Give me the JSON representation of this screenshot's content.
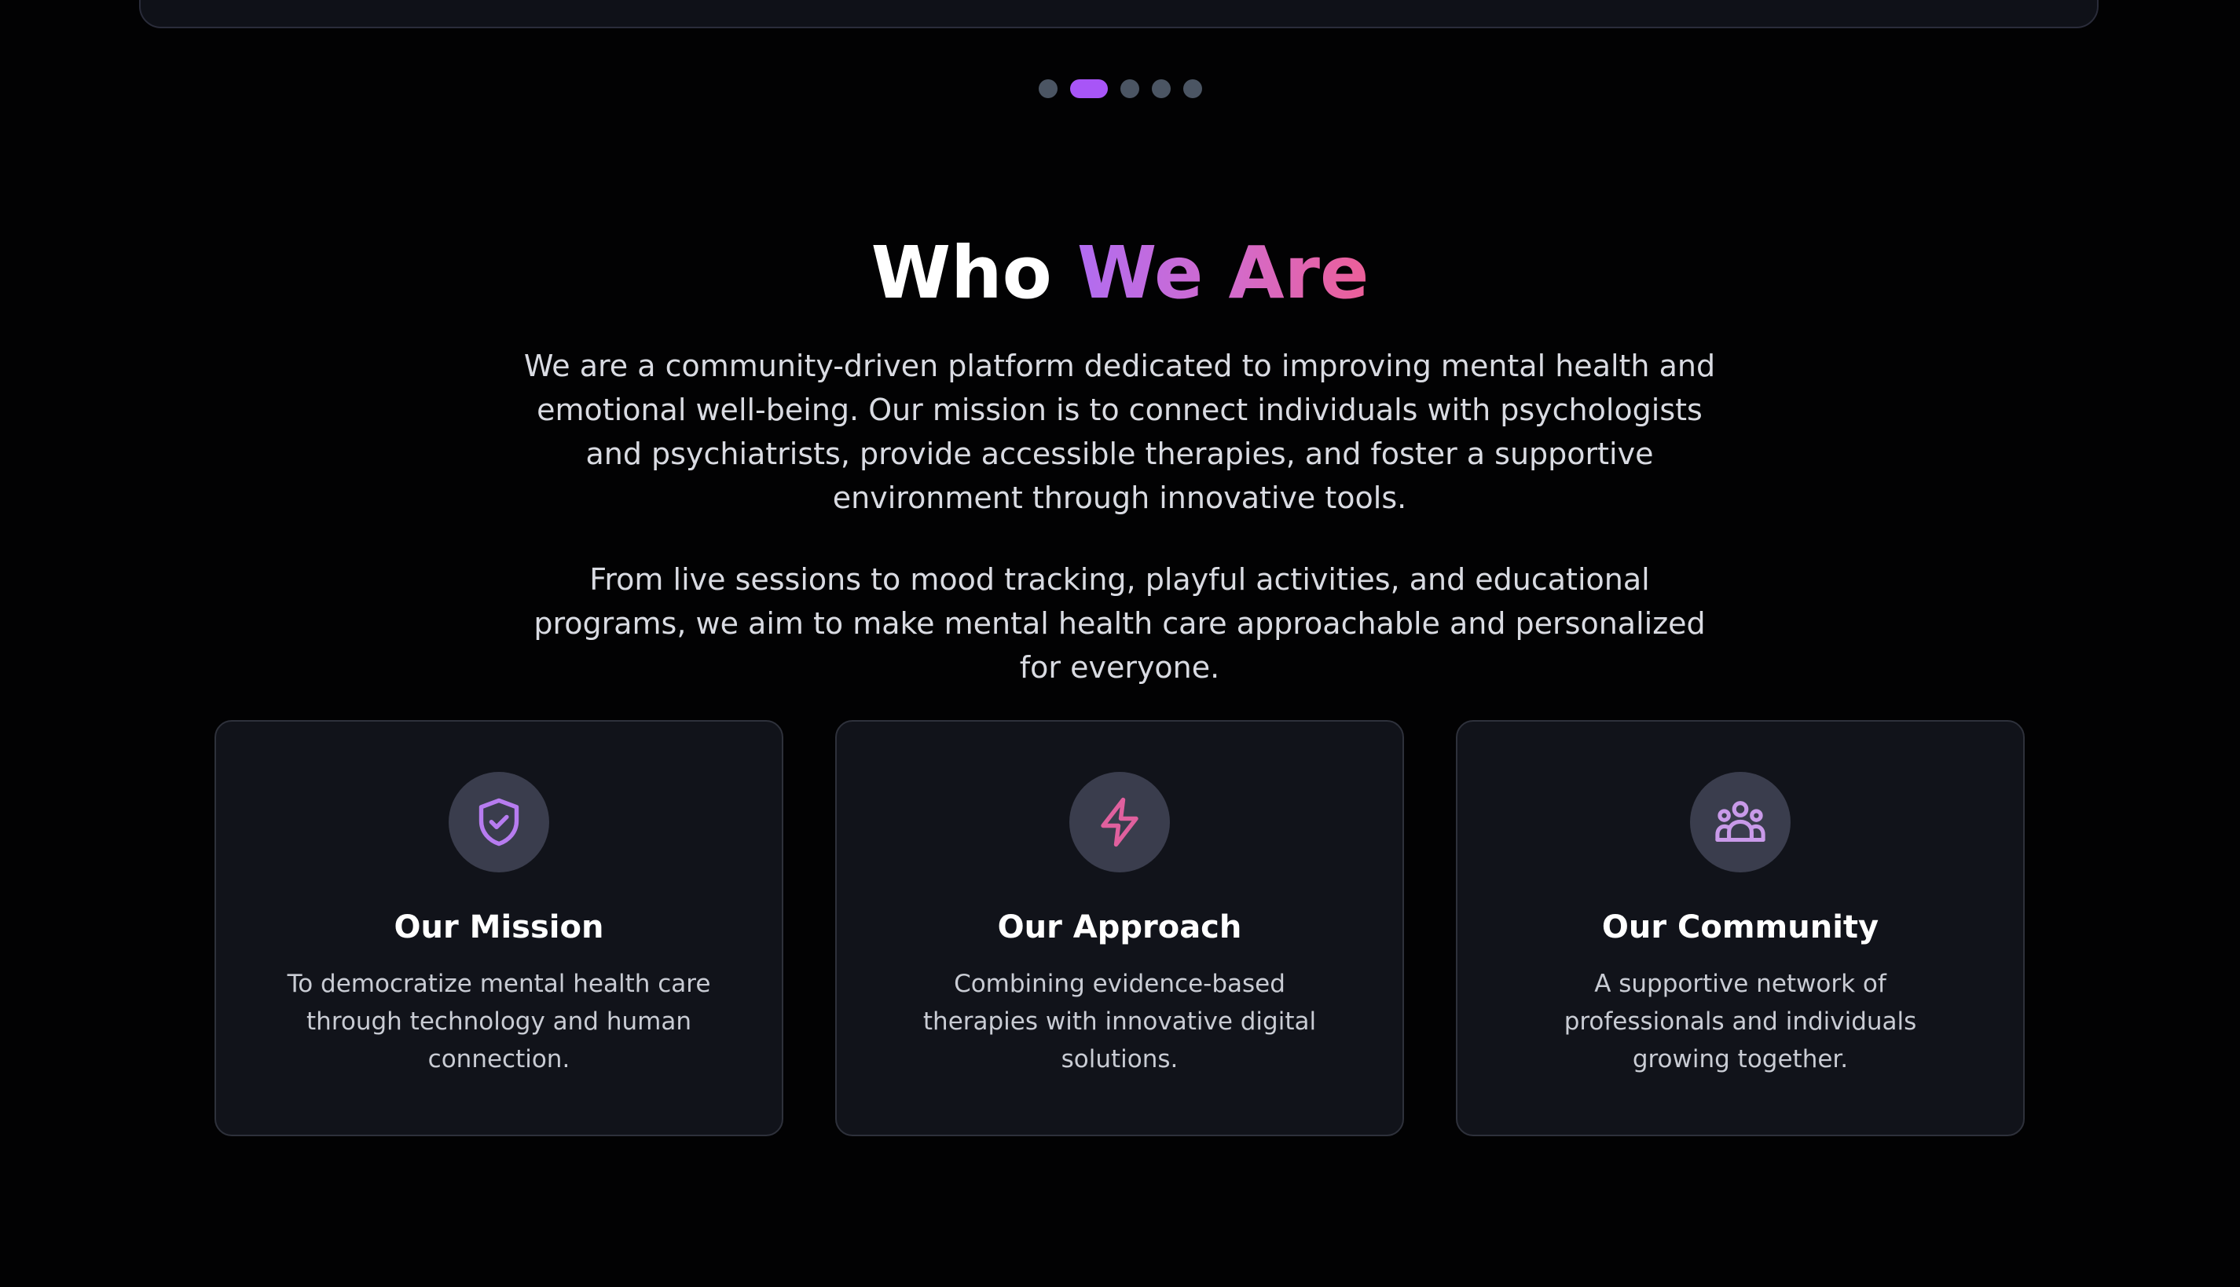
{
  "carousel": {
    "indicator_count": 5,
    "active_index": 1,
    "active_color": "#a855f7",
    "inactive_color": "#4b5563"
  },
  "about": {
    "heading_plain": "Who",
    "heading_accent": "We Are",
    "accent_gradient": [
      "#b16cf1",
      "#ec5f98"
    ],
    "paragraph1": "We are a community-driven platform dedicated to improving mental health and emotional well-being. Our mission is to connect individuals with psychologists and psychiatrists, provide accessible therapies, and foster a supportive environment through innovative tools.",
    "paragraph2": "From live sessions to mood tracking, playful activities, and educational programs, we aim to make mental health care approachable and personalized for everyone."
  },
  "cards": [
    {
      "icon": "shield-check-icon",
      "title": "Our Mission",
      "description": "To democratize mental health care through technology and human connection."
    },
    {
      "icon": "lightning-bolt-icon",
      "title": "Our Approach",
      "description": "Combining evidence-based therapies with innovative digital solutions."
    },
    {
      "icon": "users-group-icon",
      "title": "Our Community",
      "description": "A supportive network of professionals and individuals growing together."
    }
  ]
}
